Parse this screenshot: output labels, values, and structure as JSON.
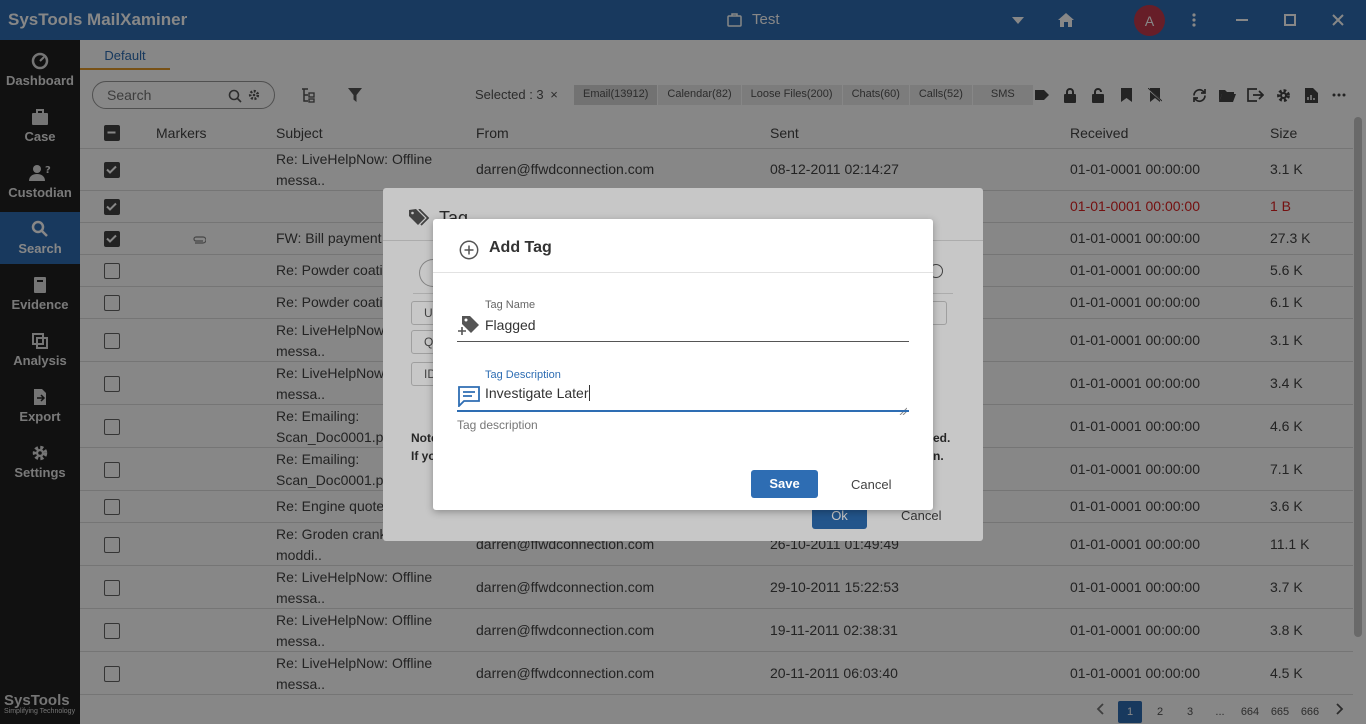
{
  "app": {
    "name": "SysTools MailXaminer",
    "case": "Test",
    "avatar_letter": "A"
  },
  "sidebar": {
    "items": [
      {
        "label": "Dashboard"
      },
      {
        "label": "Case"
      },
      {
        "label": "Custodian"
      },
      {
        "label": "Search"
      },
      {
        "label": "Evidence"
      },
      {
        "label": "Analysis"
      },
      {
        "label": "Export"
      },
      {
        "label": "Settings"
      }
    ],
    "brand": "SysTools",
    "brand_tagline": "Simplifying Technology"
  },
  "tabs": {
    "default": "Default"
  },
  "toolbar": {
    "search_placeholder": "Search",
    "selected": "Selected : 3",
    "categories": [
      "Email(13912)",
      "Calendar(82)",
      "Loose Files(200)",
      "Chats(60)",
      "Calls(52)",
      "SMS"
    ]
  },
  "table": {
    "headers": {
      "markers": "Markers",
      "subject": "Subject",
      "from": "From",
      "sent": "Sent",
      "received": "Received",
      "size": "Size"
    },
    "rows": [
      {
        "checked": true,
        "subject1": "Re: LiveHelpNow: Offline",
        "subject2": "messa..",
        "from": "darren@ffwdconnection.com",
        "sent": "08-12-2011 02:14:27",
        "received": "01-01-0001 00:00:00",
        "size": "3.1 K"
      },
      {
        "checked": true,
        "subject1": "",
        "subject2": "",
        "from": "",
        "sent": "",
        "received": "01-01-0001 00:00:00",
        "size": "1 B"
      },
      {
        "checked": true,
        "subject1": "FW: Bill payment",
        "subject2": "",
        "from": "",
        "sent": "",
        "received": "01-01-0001 00:00:00",
        "size": "27.3 K"
      },
      {
        "checked": false,
        "subject1": "Re: Powder coatin",
        "subject2": "",
        "from": "",
        "sent": "",
        "received": "01-01-0001 00:00:00",
        "size": "5.6 K"
      },
      {
        "checked": false,
        "subject1": "Re: Powder coatin",
        "subject2": "",
        "from": "",
        "sent": "",
        "received": "01-01-0001 00:00:00",
        "size": "6.1 K"
      },
      {
        "checked": false,
        "subject1": "Re: LiveHelpNow:",
        "subject2": "messa..",
        "from": "",
        "sent": "",
        "received": "01-01-0001 00:00:00",
        "size": "3.1 K"
      },
      {
        "checked": false,
        "subject1": "Re: LiveHelpNow:",
        "subject2": "messa..",
        "from": "",
        "sent": "",
        "received": "01-01-0001 00:00:00",
        "size": "3.4 K"
      },
      {
        "checked": false,
        "subject1": "Re: Emailing:",
        "subject2": "Scan_Doc0001.pc",
        "from": "",
        "sent": "",
        "received": "01-01-0001 00:00:00",
        "size": "4.6 K"
      },
      {
        "checked": false,
        "subject1": "Re: Emailing:",
        "subject2": "Scan_Doc0001.pc",
        "from": "",
        "sent": "",
        "received": "01-01-0001 00:00:00",
        "size": "7.1 K"
      },
      {
        "checked": false,
        "subject1": "Re: Engine quote",
        "subject2": "",
        "from": "",
        "sent": "",
        "received": "01-01-0001 00:00:00",
        "size": "3.6 K"
      },
      {
        "checked": false,
        "subject1": "Re: Groden crank",
        "subject2": "moddi..",
        "from": "darren@ffwdconnection.com",
        "sent": "26-10-2011 01:49:49",
        "received": "01-01-0001 00:00:00",
        "size": "11.1 K"
      },
      {
        "checked": false,
        "subject1": "Re: LiveHelpNow: Offline",
        "subject2": "messa..",
        "from": "darren@ffwdconnection.com",
        "sent": "29-10-2011 15:22:53",
        "received": "01-01-0001 00:00:00",
        "size": "3.7 K"
      },
      {
        "checked": false,
        "subject1": "Re: LiveHelpNow: Offline",
        "subject2": "messa..",
        "from": "darren@ffwdconnection.com",
        "sent": "19-11-2011 02:38:31",
        "received": "01-01-0001 00:00:00",
        "size": "3.8 K"
      },
      {
        "checked": false,
        "subject1": "Re: LiveHelpNow: Offline",
        "subject2": "messa..",
        "from": "darren@ffwdconnection.com",
        "sent": "20-11-2011 06:03:40",
        "received": "01-01-0001 00:00:00",
        "size": "4.5 K"
      }
    ]
  },
  "pager": {
    "pages": [
      "1",
      "2",
      "3",
      "...",
      "664",
      "665",
      "666"
    ],
    "active": "1"
  },
  "tag_dialog": {
    "title": "Tag",
    "pills": [
      "U",
      "Q",
      "ID"
    ],
    "note1": "Note",
    "note1_tail": "ed.",
    "note2": "If yo",
    "note2_tail": "n.",
    "ok": "Ok",
    "cancel": "Cancel"
  },
  "add_tag": {
    "title": "Add Tag",
    "name_label": "Tag Name",
    "name_value": "Flagged",
    "desc_label": "Tag Description",
    "desc_value": "Investigate Later",
    "hint": "Tag description",
    "save": "Save",
    "cancel": "Cancel"
  },
  "colors": {
    "brand": "#2e6db3",
    "sidebar": "#232323",
    "accent": "#e49a2b",
    "avatar": "#c43a4d",
    "alert": "#dd2222"
  }
}
